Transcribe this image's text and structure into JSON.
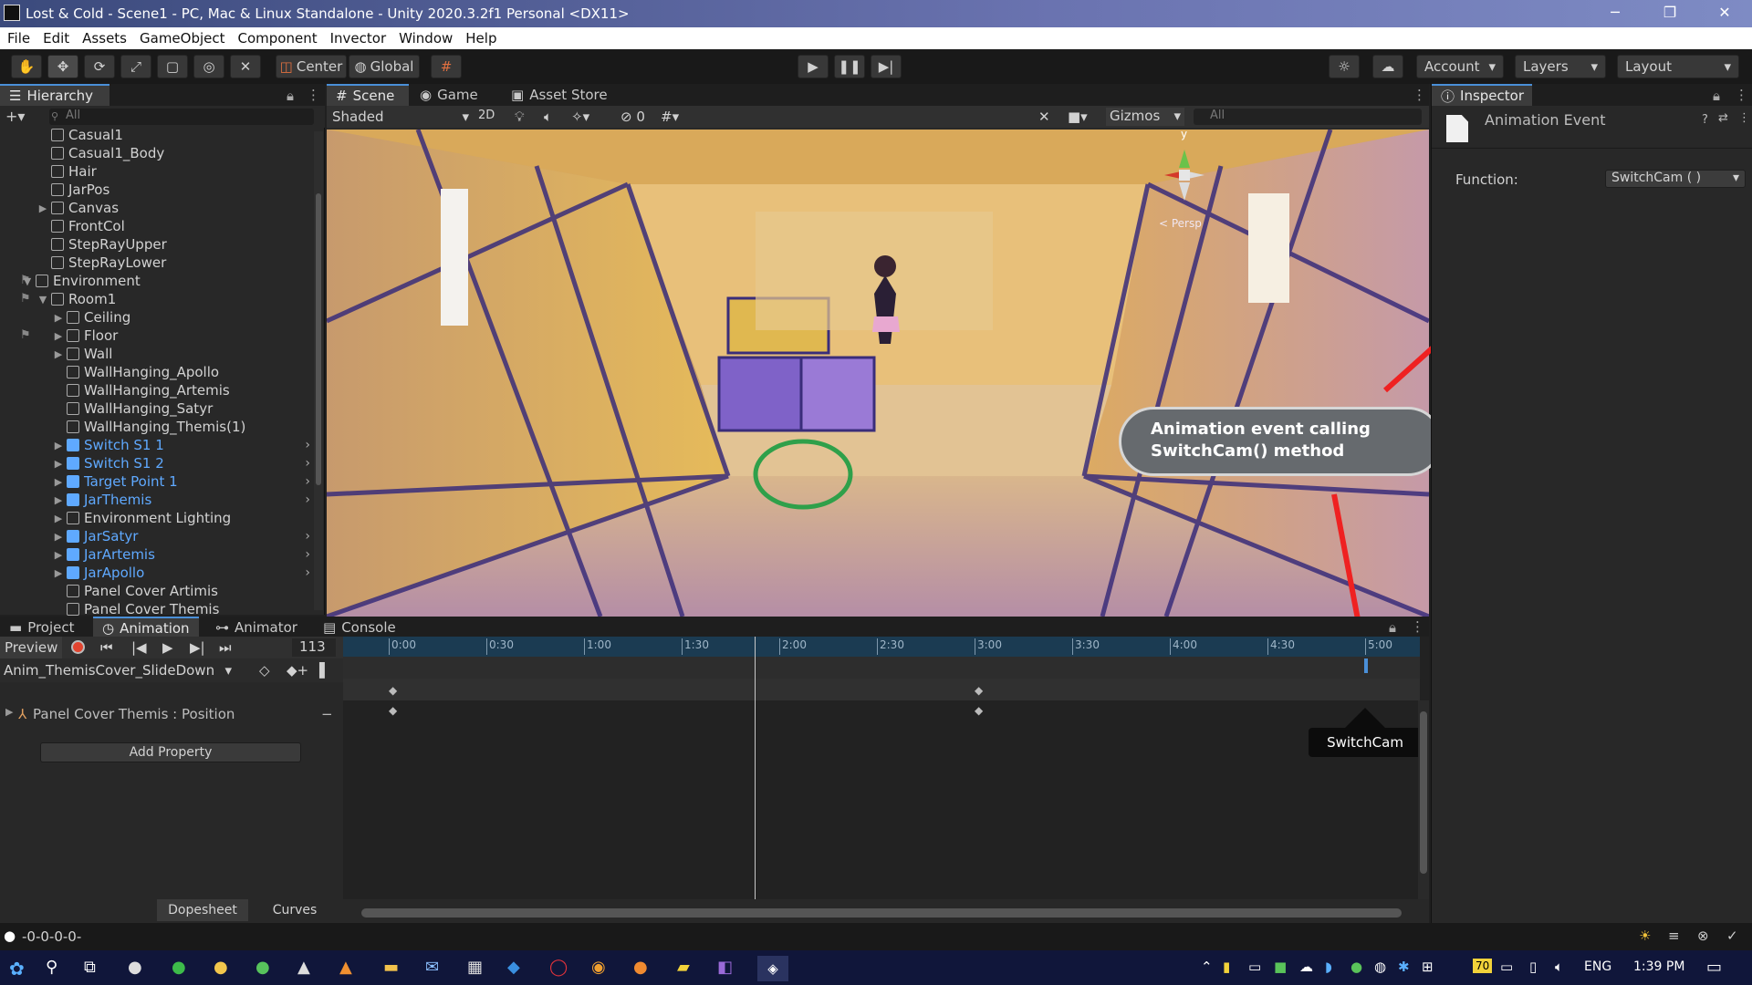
{
  "window": {
    "title": "Lost & Cold - Scene1 - PC, Mac & Linux Standalone - Unity 2020.3.2f1 Personal <DX11>",
    "min": "─",
    "max": "❐",
    "close": "✕"
  },
  "menu": [
    "File",
    "Edit",
    "Assets",
    "GameObject",
    "Component",
    "Invector",
    "Window",
    "Help"
  ],
  "toolbar": {
    "center": "Center",
    "global": "Global",
    "account": "Account",
    "layers": "Layers",
    "layout": "Layout"
  },
  "hierarchy": {
    "title": "Hierarchy",
    "search_placeholder": "All",
    "items": [
      {
        "label": "Casual1",
        "indent": 3,
        "arrow": false,
        "blue": false
      },
      {
        "label": "Casual1_Body",
        "indent": 3,
        "arrow": false,
        "blue": false
      },
      {
        "label": "Hair",
        "indent": 3,
        "arrow": false,
        "blue": false
      },
      {
        "label": "JarPos",
        "indent": 3,
        "arrow": false,
        "blue": false
      },
      {
        "label": "Canvas",
        "indent": 3,
        "arrow": true,
        "blue": false
      },
      {
        "label": "FrontCol",
        "indent": 3,
        "arrow": false,
        "blue": false
      },
      {
        "label": "StepRayUpper",
        "indent": 3,
        "arrow": false,
        "blue": false
      },
      {
        "label": "StepRayLower",
        "indent": 3,
        "arrow": false,
        "blue": false
      },
      {
        "label": "Environment",
        "indent": 2,
        "arrow": "open",
        "blue": false
      },
      {
        "label": "Room1",
        "indent": 3,
        "arrow": "open",
        "blue": false
      },
      {
        "label": "Ceiling",
        "indent": 4,
        "arrow": true,
        "blue": false
      },
      {
        "label": "Floor",
        "indent": 4,
        "arrow": true,
        "blue": false
      },
      {
        "label": "Wall",
        "indent": 4,
        "arrow": true,
        "blue": false
      },
      {
        "label": "WallHanging_Apollo",
        "indent": 4,
        "arrow": false,
        "blue": false
      },
      {
        "label": "WallHanging_Artemis",
        "indent": 4,
        "arrow": false,
        "blue": false
      },
      {
        "label": "WallHanging_Satyr",
        "indent": 4,
        "arrow": false,
        "blue": false
      },
      {
        "label": "WallHanging_Themis(1)",
        "indent": 4,
        "arrow": false,
        "blue": false
      },
      {
        "label": "Switch S1 1",
        "indent": 4,
        "arrow": true,
        "blue": true
      },
      {
        "label": "Switch S1 2",
        "indent": 4,
        "arrow": true,
        "blue": true
      },
      {
        "label": "Target Point 1",
        "indent": 4,
        "arrow": true,
        "blue": true
      },
      {
        "label": "JarThemis",
        "indent": 4,
        "arrow": true,
        "blue": true
      },
      {
        "label": "Environment Lighting",
        "indent": 4,
        "arrow": true,
        "blue": false
      },
      {
        "label": "JarSatyr",
        "indent": 4,
        "arrow": true,
        "blue": true
      },
      {
        "label": "JarArtemis",
        "indent": 4,
        "arrow": true,
        "blue": true
      },
      {
        "label": "JarApollo",
        "indent": 4,
        "arrow": true,
        "blue": true
      },
      {
        "label": "Panel Cover Artimis",
        "indent": 4,
        "arrow": false,
        "blue": false
      },
      {
        "label": "Panel Cover Themis",
        "indent": 4,
        "arrow": false,
        "blue": false
      }
    ]
  },
  "scene": {
    "tabs": [
      "Scene",
      "Game",
      "Asset Store"
    ],
    "shading": "Shaded",
    "mode2d": "2D",
    "hidden_count": "0",
    "gizmos": "Gizmos",
    "search_placeholder": "All",
    "persp": "< Persp"
  },
  "inspector": {
    "title": "Inspector",
    "object": "Animation Event",
    "function_label": "Function:",
    "function_value": "SwitchCam ( )"
  },
  "callout": "Animation event calling SwitchCam() method",
  "animation": {
    "tabs": [
      "Project",
      "Animation",
      "Animator",
      "Console"
    ],
    "preview": "Preview",
    "frame": "113",
    "clip": "Anim_ThemisCover_SlideDown",
    "property": "Panel Cover Themis : Position",
    "add_property": "Add Property",
    "ticks": [
      "0:00",
      "0:30",
      "1:00",
      "1:30",
      "2:00",
      "2:30",
      "3:00",
      "3:30",
      "4:00",
      "4:30",
      "5:00"
    ],
    "event_tooltip": "SwitchCam",
    "dopesheet": "Dopesheet",
    "curves": "Curves"
  },
  "status": {
    "text": "-0-0-0-0-"
  },
  "taskbar": {
    "lang": "ENG",
    "time": "1:39 PM",
    "badge": "70"
  }
}
